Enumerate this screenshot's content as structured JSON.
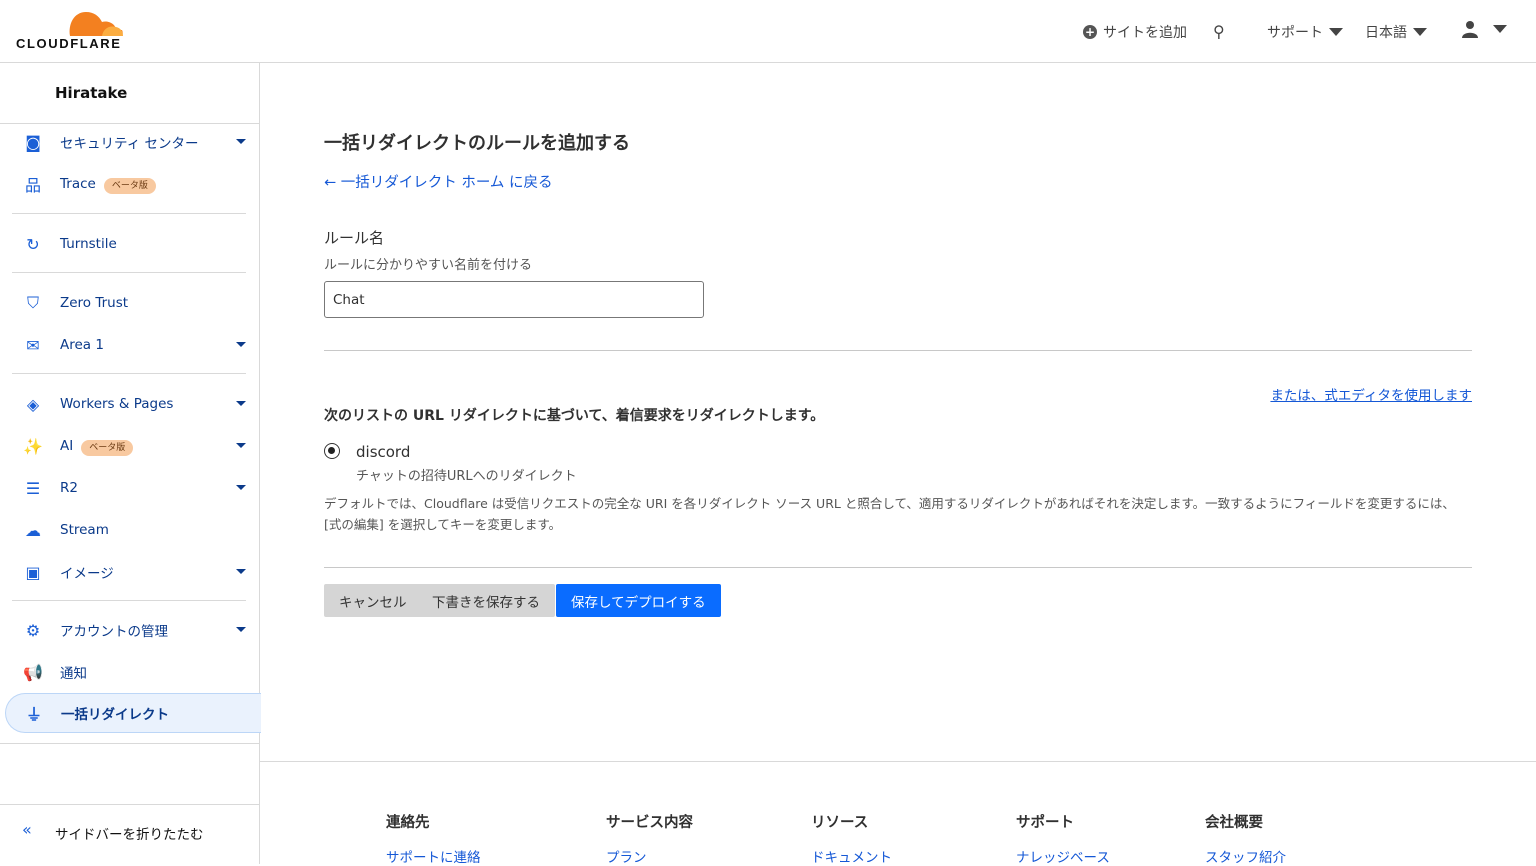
{
  "brand": {
    "name": "CLOUDFLARE",
    "color": "#f38020"
  },
  "topnav": {
    "add_site": "サイトを追加",
    "support": "サポート",
    "language": "日本語"
  },
  "sidebar": {
    "account": "Hiratake",
    "beta": "ベータ版",
    "collapse": "サイドバーを折りたたむ",
    "items": [
      {
        "label": "セキュリティ センター",
        "icon": "security-center-icon"
      },
      {
        "label": "Trace",
        "icon": "trace-icon"
      },
      {
        "label": "Turnstile",
        "icon": "turnstile-icon"
      },
      {
        "label": "Zero Trust",
        "icon": "zero-trust-icon"
      },
      {
        "label": "Area 1",
        "icon": "area1-icon"
      },
      {
        "label": "Workers & Pages",
        "icon": "workers-icon"
      },
      {
        "label": "AI",
        "icon": "ai-icon"
      },
      {
        "label": "R2",
        "icon": "database-icon"
      },
      {
        "label": "Stream",
        "icon": "stream-icon"
      },
      {
        "label": "イメージ",
        "icon": "image-icon"
      },
      {
        "label": "アカウントの管理",
        "icon": "gear-icon"
      },
      {
        "label": "通知",
        "icon": "megaphone-icon"
      },
      {
        "label": "一括リダイレクト",
        "icon": "bulk-redirect-icon",
        "active": true
      }
    ]
  },
  "main": {
    "title": "一括リダイレクトのルールを追加する",
    "back": "← 一括リダイレクト ホーム に戻る",
    "rule_name_label": "ルール名",
    "rule_name_help": "ルールに分かりやすい名前を付ける",
    "rule_name_value": "Chat",
    "expression_link": "または、式エディタを使用します",
    "list_desc": "次のリストの URL リダイレクトに基づいて、着信要求をリダイレクトします。",
    "list": {
      "name": "discord",
      "desc": "チャットの招待URLへのリダイレクト",
      "selected": true
    },
    "note": "デフォルトでは、Cloudflare は受信リクエストの完全な URI を各リダイレクト ソース URL と照合して、適用するリダイレクトがあればそれを決定します。一致するようにフィールドを変更するには、[式の編集] を選択してキーを変更します。",
    "cancel": "キャンセル",
    "save_draft": "下書きを保存する",
    "deploy": "保存してデプロイする"
  },
  "footer": [
    {
      "title": "連絡先",
      "link": "サポートに連絡"
    },
    {
      "title": "サービス内容",
      "link": "プラン"
    },
    {
      "title": "リソース",
      "link": "ドキュメント"
    },
    {
      "title": "サポート",
      "link": "ナレッジベース"
    },
    {
      "title": "会社概要",
      "link": "スタッフ紹介"
    }
  ]
}
